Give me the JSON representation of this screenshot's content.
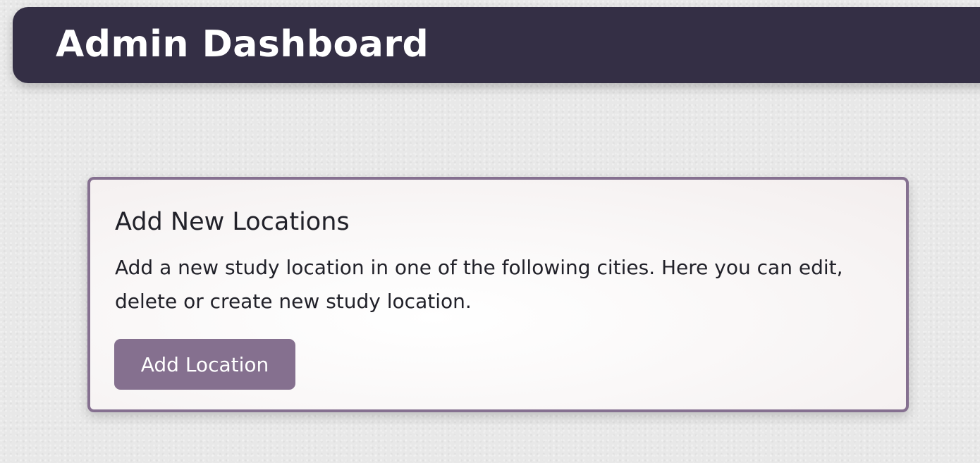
{
  "header": {
    "title": "Admin Dashboard"
  },
  "card": {
    "title": "Add New Locations",
    "description": "Add a new study location in one of the following cities. Here you can edit, delete or create new study location.",
    "button_label": "Add Location"
  },
  "colors": {
    "header_background": "#342f45",
    "accent": "#85708f",
    "page_background": "#e8e8e8",
    "text": "#212129"
  }
}
